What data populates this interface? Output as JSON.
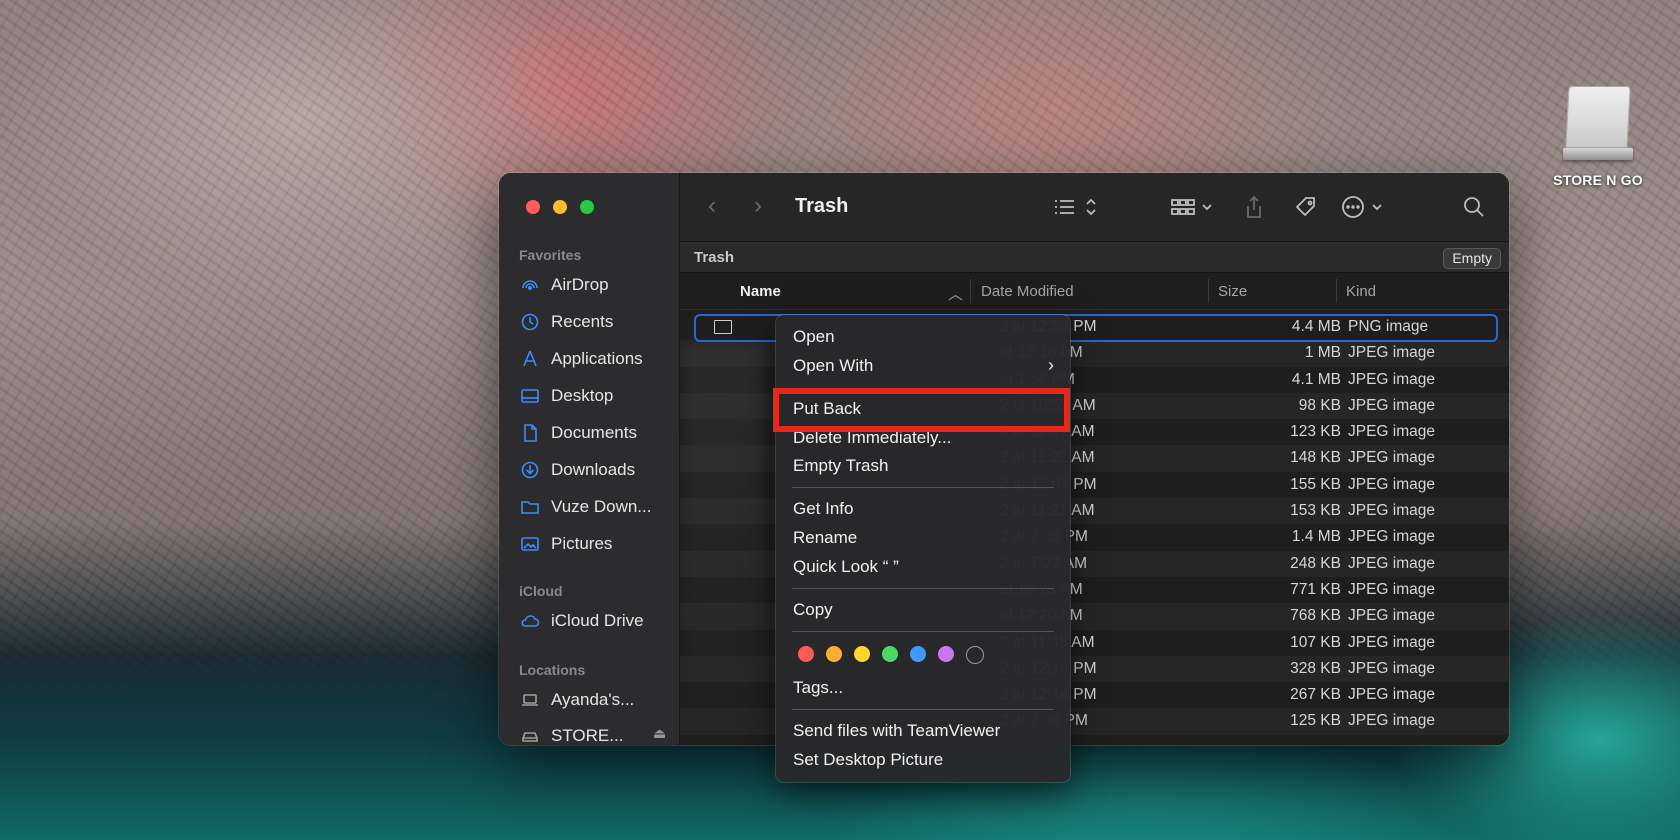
{
  "desktop": {
    "drive_label": "STORE N GO"
  },
  "window": {
    "title": "Trash",
    "path_title": "Trash",
    "empty_button": "Empty"
  },
  "sidebar": {
    "favorites_title": "Favorites",
    "favorites": [
      {
        "label": "AirDrop",
        "icon": "airdrop-icon"
      },
      {
        "label": "Recents",
        "icon": "clock-icon"
      },
      {
        "label": "Applications",
        "icon": "applications-icon"
      },
      {
        "label": "Desktop",
        "icon": "desktop-icon"
      },
      {
        "label": "Documents",
        "icon": "document-icon"
      },
      {
        "label": "Downloads",
        "icon": "download-icon"
      },
      {
        "label": "Vuze Down...",
        "icon": "folder-icon"
      },
      {
        "label": "Pictures",
        "icon": "pictures-icon"
      }
    ],
    "icloud_title": "iCloud",
    "icloud": [
      {
        "label": "iCloud Drive",
        "icon": "cloud-icon"
      }
    ],
    "locations_title": "Locations",
    "locations": [
      {
        "label": "Ayanda's...",
        "icon": "laptop-icon"
      },
      {
        "label": "STORE...",
        "icon": "drive-icon"
      }
    ]
  },
  "columns": {
    "name": "Name",
    "date": "Date Modified",
    "size": "Size",
    "kind": "Kind"
  },
  "rows": [
    {
      "char": "",
      "date": "2 at 12:58 PM",
      "size": "4.4 MB",
      "kind": "PNG image"
    },
    {
      "char": "",
      "date": "at 12:18 AM",
      "size": "1 MB",
      "kind": "JPEG image"
    },
    {
      "char": "",
      "date": "at 1:56 PM",
      "size": "4.1 MB",
      "kind": "JPEG image"
    },
    {
      "char": "",
      "date": "2 at 10:59 AM",
      "size": "98 KB",
      "kind": "JPEG image"
    },
    {
      "char": "",
      "date": "2 at 11:21 AM",
      "size": "123 KB",
      "kind": "JPEG image"
    },
    {
      "char": "",
      "date": "2 at 11:22 AM",
      "size": "148 KB",
      "kind": "JPEG image"
    },
    {
      "char": "",
      "date": "2 at 12:03 PM",
      "size": "155 KB",
      "kind": "JPEG image"
    },
    {
      "char": "",
      "date": "2 at 11:21 AM",
      "size": "153 KB",
      "kind": "JPEG image"
    },
    {
      "char": "",
      "date": "2 at 2:05 PM",
      "size": "1.4 MB",
      "kind": "JPEG image"
    },
    {
      "char": "",
      "date": "2 at 7:27 AM",
      "size": "248 KB",
      "kind": "JPEG image"
    },
    {
      "char": "",
      "date": "at 12:23 AM",
      "size": "771 KB",
      "kind": "JPEG image"
    },
    {
      "char": "",
      "date": "at 12:20 AM",
      "size": "768 KB",
      "kind": "JPEG image"
    },
    {
      "char": "",
      "date": "2 at 11:48 AM",
      "size": "107 KB",
      "kind": "JPEG image"
    },
    {
      "char": "",
      "date": "2 at 12:14 PM",
      "size": "328 KB",
      "kind": "JPEG image"
    },
    {
      "char": "",
      "date": "2 at 12:14 PM",
      "size": "267 KB",
      "kind": "JPEG image"
    },
    {
      "char": "",
      "date": "2 at 2:06 PM",
      "size": "125 KB",
      "kind": "JPEG image"
    }
  ],
  "context_menu": {
    "open": "Open",
    "open_with": "Open With",
    "put_back": "Put Back",
    "delete_immediately": "Delete Immediately...",
    "empty_trash": "Empty Trash",
    "get_info": "Get Info",
    "rename": "Rename",
    "quick_look": "Quick Look “ ”",
    "copy": "Copy",
    "tags": "Tags...",
    "teamviewer": "Send files with TeamViewer",
    "set_desktop": "Set Desktop Picture",
    "tag_colors": [
      "#ff5b55",
      "#ffae32",
      "#ffd52e",
      "#4cd964",
      "#3d9bff",
      "#c977f0",
      "transparent"
    ]
  },
  "colors": {
    "selection": "#2a66d9",
    "highlight": "#e6271b"
  }
}
